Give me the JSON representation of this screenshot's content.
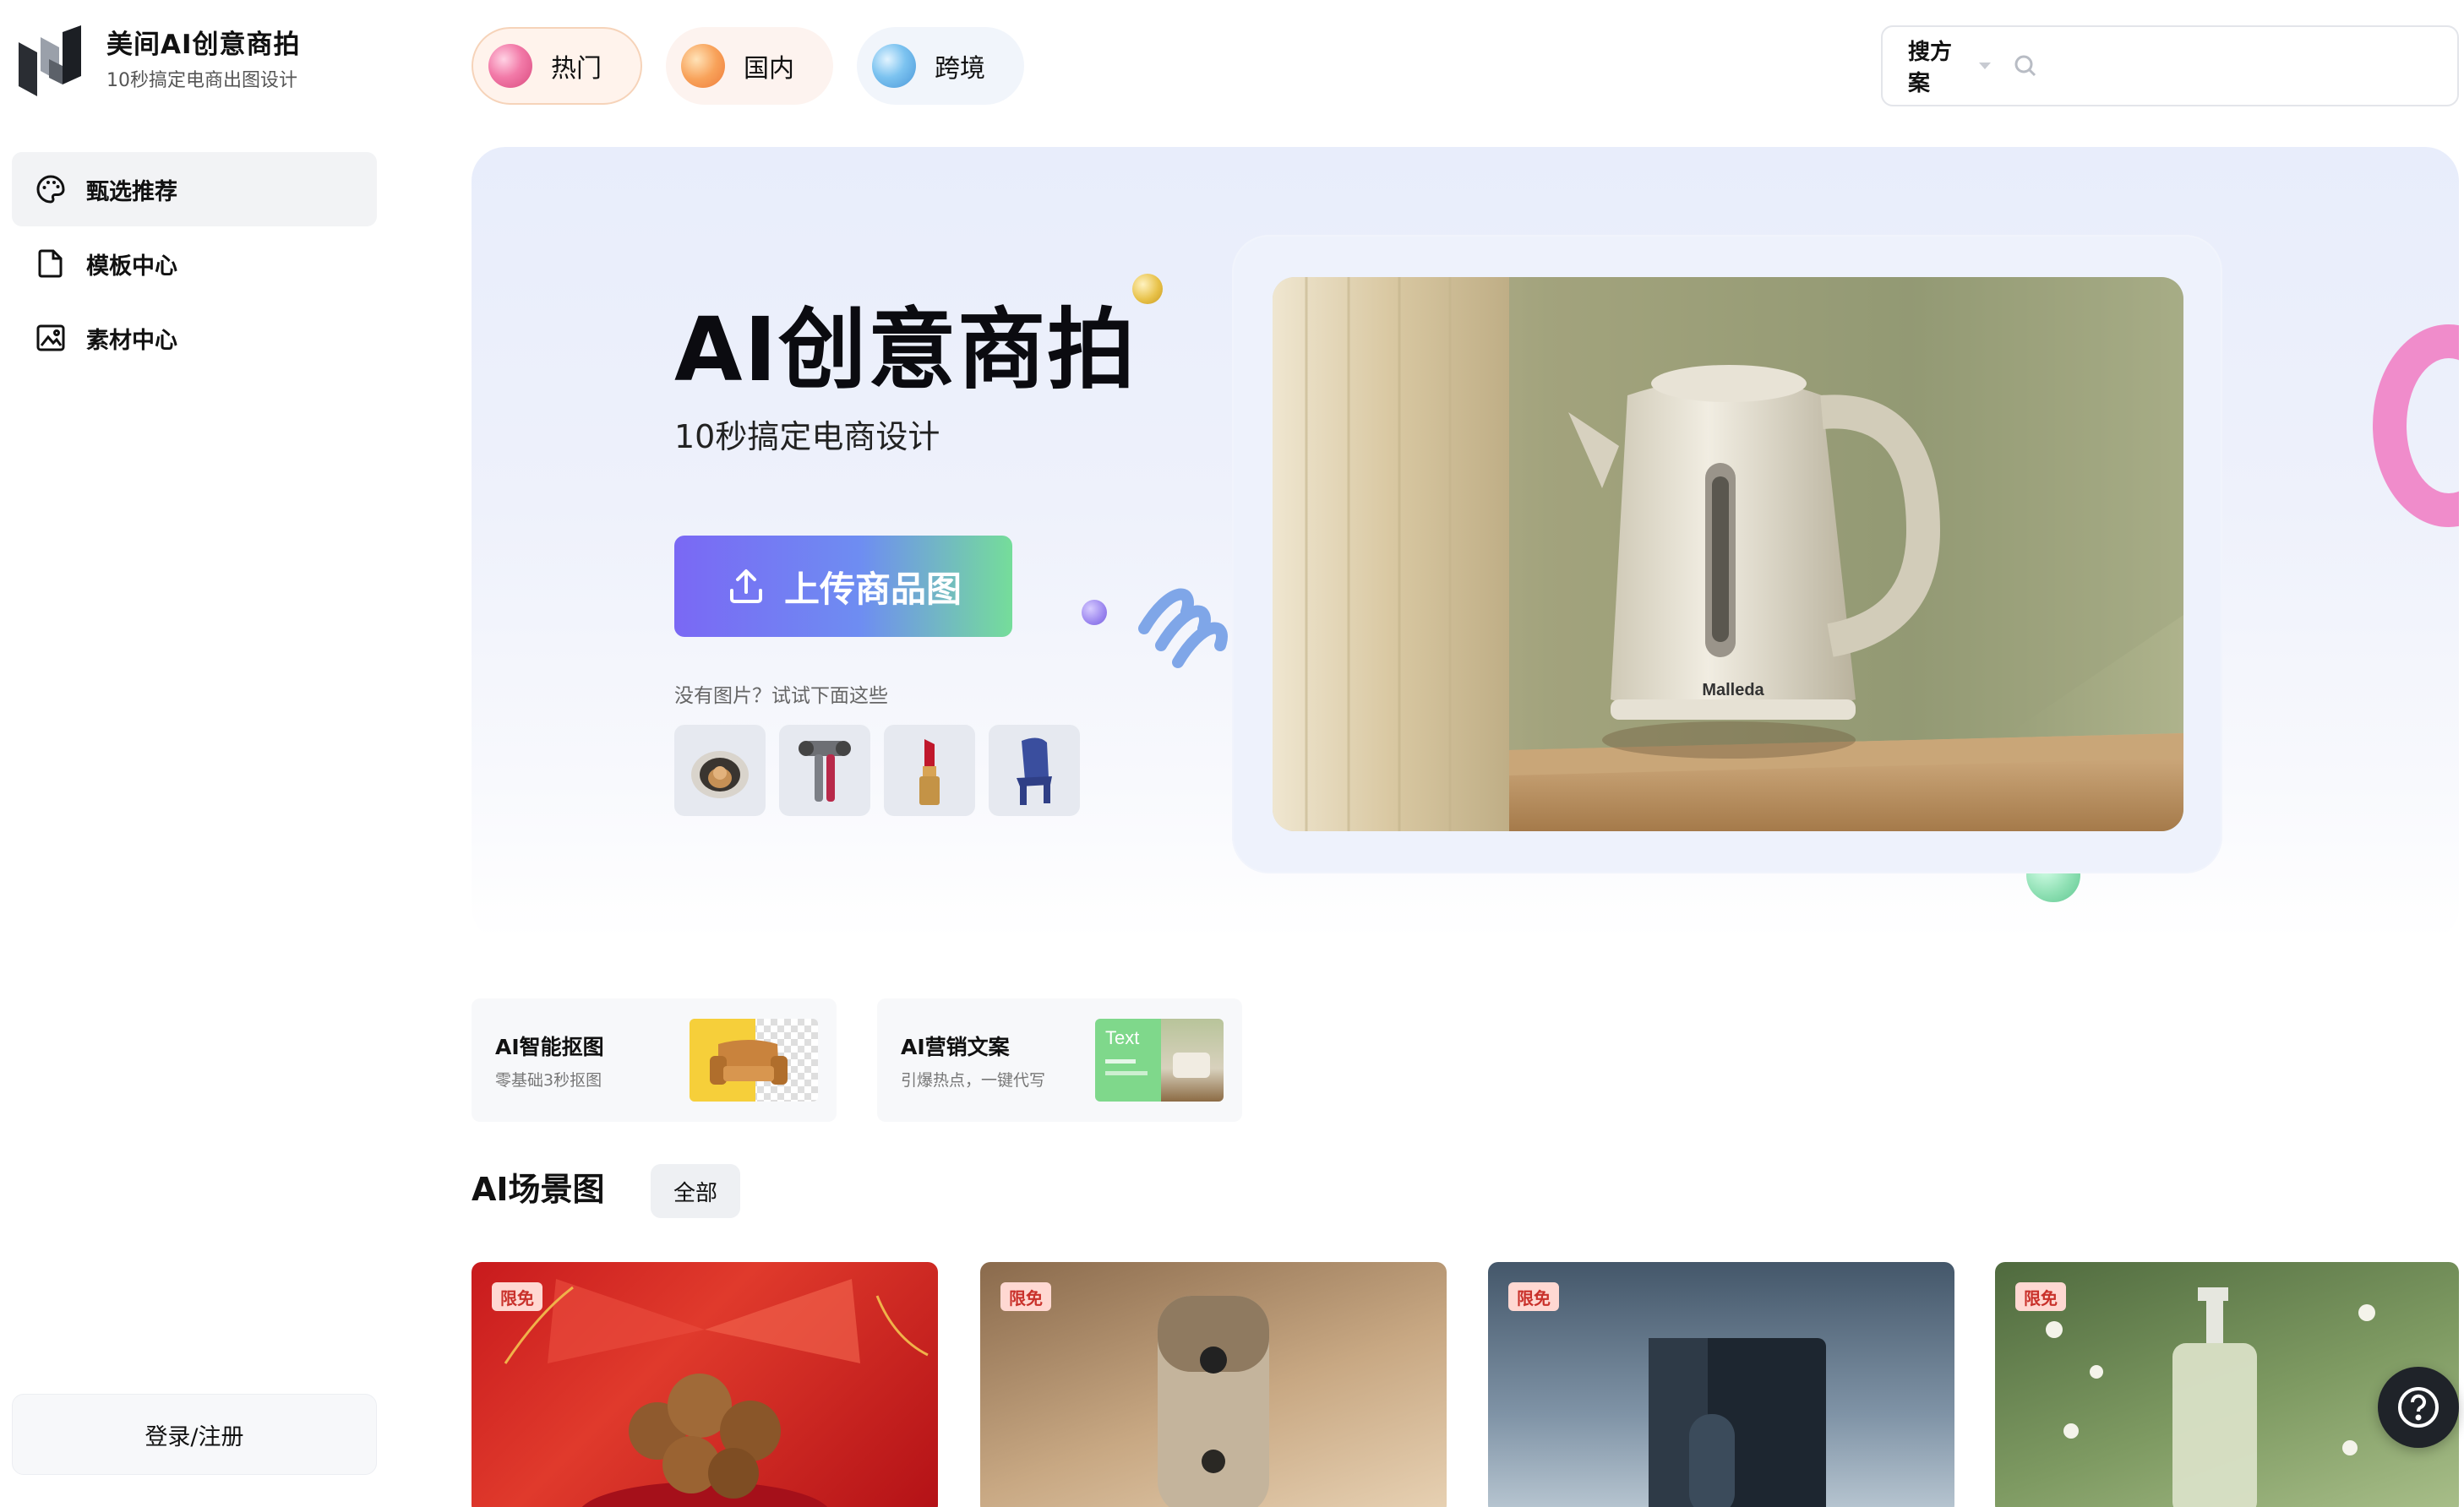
{
  "brand": {
    "title": "美间AI创意商拍",
    "subtitle": "10秒搞定电商出图设计"
  },
  "sidebar": {
    "items": [
      {
        "label": "甄选推荐",
        "icon": "palette-icon",
        "active": true
      },
      {
        "label": "模板中心",
        "icon": "document-icon",
        "active": false
      },
      {
        "label": "素材中心",
        "icon": "image-icon",
        "active": false
      }
    ],
    "login_label": "登录/注册"
  },
  "tabs": [
    {
      "label": "热门",
      "icon": "pink-ball-icon",
      "active": true
    },
    {
      "label": "国内",
      "icon": "orange-ball-icon",
      "active": false
    },
    {
      "label": "跨境",
      "icon": "blue-ball-icon",
      "active": false
    }
  ],
  "search": {
    "type_label": "搜方案",
    "placeholder": ""
  },
  "hero": {
    "title": "AI创意商拍",
    "subtitle": "10秒搞定电商设计",
    "upload_label": "上传商品图",
    "try_hint": "没有图片？试试下面这些",
    "samples": [
      "pet-bed",
      "hair-dryer",
      "lipstick",
      "chair"
    ],
    "product_brand": "Malleda"
  },
  "features": [
    {
      "title": "AI智能抠图",
      "subtitle": "零基础3秒抠图"
    },
    {
      "title": "AI营销文案",
      "subtitle": "引爆热点，一键代写",
      "badge": "Text"
    }
  ],
  "section": {
    "title": "AI场景图",
    "filter_label": "全部"
  },
  "cards": [
    {
      "tag": "限免",
      "subject": "walnuts"
    },
    {
      "tag": "限免",
      "subject": "speaker"
    },
    {
      "tag": "限免",
      "subject": "water-purifier"
    },
    {
      "tag": "限免",
      "subject": "pump-bottle"
    }
  ],
  "colors": {
    "accent_gradient_start": "#7a68f4",
    "accent_gradient_end": "#75dd9a",
    "tag_bg": "#ffd8d2",
    "tag_text": "#c9312b"
  }
}
